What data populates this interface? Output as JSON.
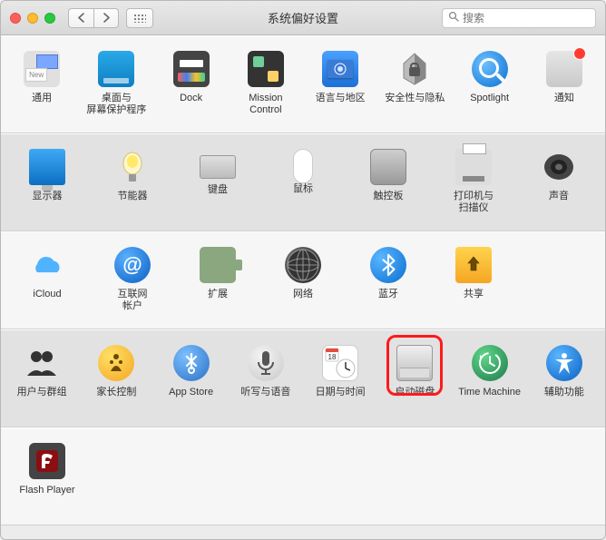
{
  "window": {
    "title": "系统偏好设置"
  },
  "search": {
    "placeholder": "搜索",
    "value": ""
  },
  "sections": [
    {
      "tone": "light",
      "items": [
        {
          "key": "general",
          "label": "通用",
          "icon": "general"
        },
        {
          "key": "desktop",
          "label": "桌面与\n屏幕保护程序",
          "icon": "desktop"
        },
        {
          "key": "dock",
          "label": "Dock",
          "icon": "dock"
        },
        {
          "key": "mission",
          "label": "Mission\nControl",
          "icon": "mission"
        },
        {
          "key": "language",
          "label": "语言与地区",
          "icon": "language"
        },
        {
          "key": "security",
          "label": "安全性与隐私",
          "icon": "security"
        },
        {
          "key": "spotlight",
          "label": "Spotlight",
          "icon": "spotlight"
        },
        {
          "key": "notify",
          "label": "通知",
          "icon": "notify",
          "badge": true,
          "col": 8
        }
      ]
    },
    {
      "tone": "dark",
      "items": [
        {
          "key": "display",
          "label": "显示器",
          "icon": "display"
        },
        {
          "key": "energy",
          "label": "节能器",
          "icon": "energy"
        },
        {
          "key": "keyboard",
          "label": "键盘",
          "icon": "keyboard"
        },
        {
          "key": "mouse",
          "label": "鼠标",
          "icon": "mouse"
        },
        {
          "key": "trackpad",
          "label": "触控板",
          "icon": "trackpad"
        },
        {
          "key": "printer",
          "label": "打印机与\n扫描仪",
          "icon": "printer"
        },
        {
          "key": "sound",
          "label": "声音",
          "icon": "sound"
        }
      ]
    },
    {
      "tone": "light",
      "items": [
        {
          "key": "icloud",
          "label": "iCloud",
          "icon": "icloud"
        },
        {
          "key": "internet",
          "label": "互联网\n帐户",
          "icon": "internet"
        },
        {
          "key": "extensions",
          "label": "扩展",
          "icon": "extensions"
        },
        {
          "key": "network",
          "label": "网络",
          "icon": "network"
        },
        {
          "key": "bluetooth",
          "label": "蓝牙",
          "icon": "bluetooth"
        },
        {
          "key": "sharing",
          "label": "共享",
          "icon": "sharing"
        }
      ]
    },
    {
      "tone": "dark",
      "items": [
        {
          "key": "users",
          "label": "用户与群组",
          "icon": "users"
        },
        {
          "key": "parental",
          "label": "家长控制",
          "icon": "parental"
        },
        {
          "key": "appstore",
          "label": "App Store",
          "icon": "appstore"
        },
        {
          "key": "dictation",
          "label": "听写与语音",
          "icon": "dictation"
        },
        {
          "key": "datetime",
          "label": "日期与时间",
          "icon": "datetime"
        },
        {
          "key": "startup",
          "label": "启动磁盘",
          "icon": "startup",
          "highlight": true
        },
        {
          "key": "timemachine",
          "label": "Time Machine",
          "icon": "timemachine"
        },
        {
          "key": "accessibility",
          "label": "辅助功能",
          "icon": "accessibility",
          "col": 8
        }
      ]
    },
    {
      "tone": "light",
      "items": [
        {
          "key": "flash",
          "label": "Flash Player",
          "icon": "flash"
        }
      ]
    }
  ]
}
